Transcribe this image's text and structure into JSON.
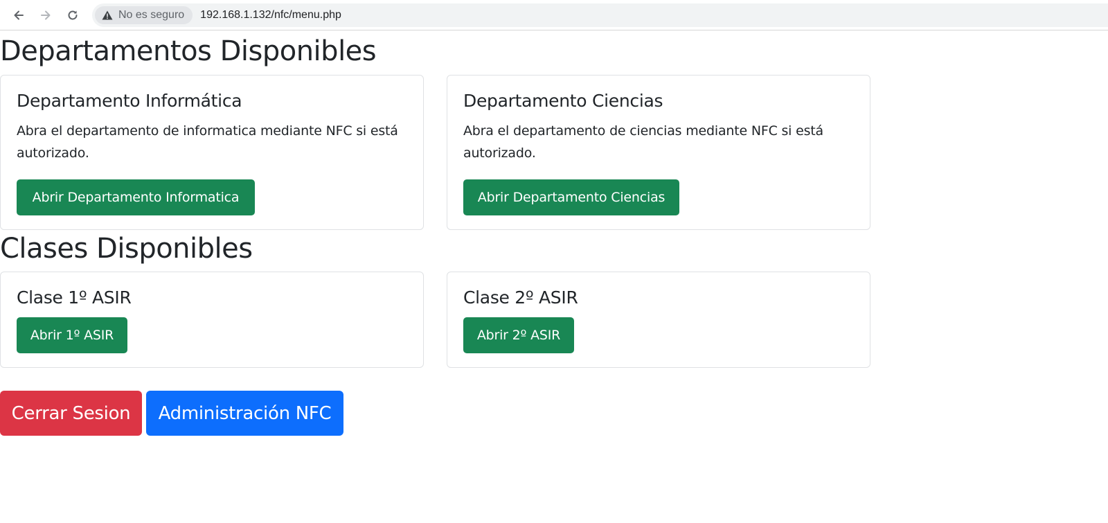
{
  "browser": {
    "back_icon": "arrow-left-icon",
    "forward_icon": "arrow-right-icon",
    "reload_icon": "reload-icon",
    "security_icon": "warning-triangle-icon",
    "security_label": "No es seguro",
    "url": "192.168.1.132/nfc/menu.php"
  },
  "departamentos": {
    "heading": "Departamentos Disponibles",
    "cards": [
      {
        "title": "Departamento Informática",
        "text": "Abra el departamento de informatica mediante NFC si está autorizado.",
        "button": "Abrir Departamento Informatica"
      },
      {
        "title": "Departamento Ciencias",
        "text": "Abra el departamento de ciencias mediante NFC si está autorizado.",
        "button": "Abrir Departamento Ciencias"
      }
    ]
  },
  "clases": {
    "heading": "Clases Disponibles",
    "cards": [
      {
        "title": "Clase 1º ASIR",
        "button": "Abrir 1º ASIR"
      },
      {
        "title": "Clase 2º ASIR",
        "button": "Abrir 2º ASIR"
      }
    ]
  },
  "actions": {
    "logout": "Cerrar Sesion",
    "admin": "Administración NFC"
  },
  "colors": {
    "success": "#198754",
    "danger": "#dc3545",
    "primary": "#0d6efd"
  }
}
